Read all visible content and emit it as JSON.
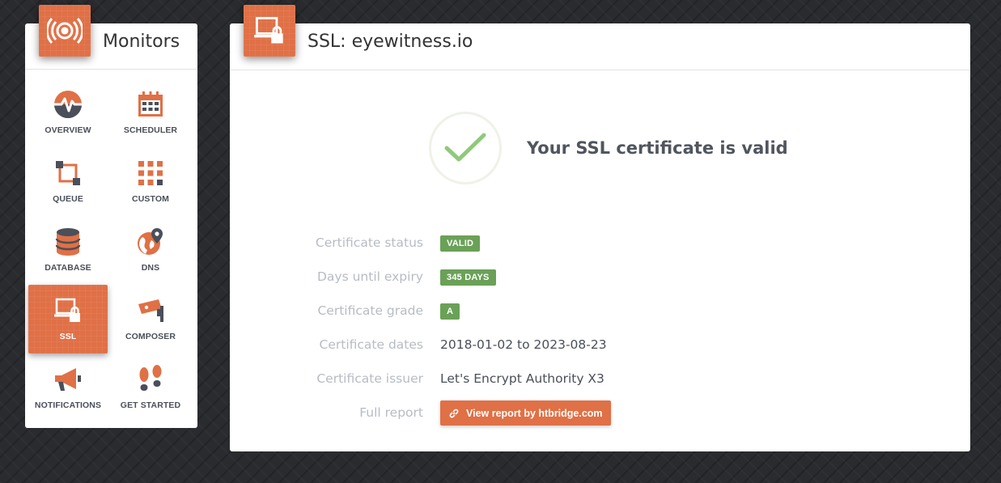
{
  "sidebar": {
    "title": "Monitors",
    "items": [
      {
        "label": "OVERVIEW"
      },
      {
        "label": "SCHEDULER"
      },
      {
        "label": "QUEUE"
      },
      {
        "label": "CUSTOM"
      },
      {
        "label": "DATABASE"
      },
      {
        "label": "DNS"
      },
      {
        "label": "SSL",
        "active": true
      },
      {
        "label": "COMPOSER"
      },
      {
        "label": "NOTIFICATIONS"
      },
      {
        "label": "GET STARTED"
      }
    ]
  },
  "main": {
    "title": "SSL: eyewitness.io",
    "status_text": "Your SSL certificate is valid",
    "details": {
      "status_label": "Certificate status",
      "status_value": "VALID",
      "expiry_label": "Days until expiry",
      "expiry_value": "345 DAYS",
      "grade_label": "Certificate grade",
      "grade_value": "A",
      "dates_label": "Certificate dates",
      "dates_value": "2018-01-02 to 2023-08-23",
      "issuer_label": "Certificate issuer",
      "issuer_value": "Let's Encrypt Authority X3",
      "report_label": "Full report",
      "report_button": "View report by htbridge.com"
    }
  },
  "colors": {
    "accent": "#e07046",
    "success": "#6aa157",
    "check": "#8fc97a"
  },
  "icons": {
    "monitors": "broadcast-icon",
    "ssl": "laptop-lock-icon",
    "check": "checkmark-icon",
    "report": "link-icon"
  }
}
